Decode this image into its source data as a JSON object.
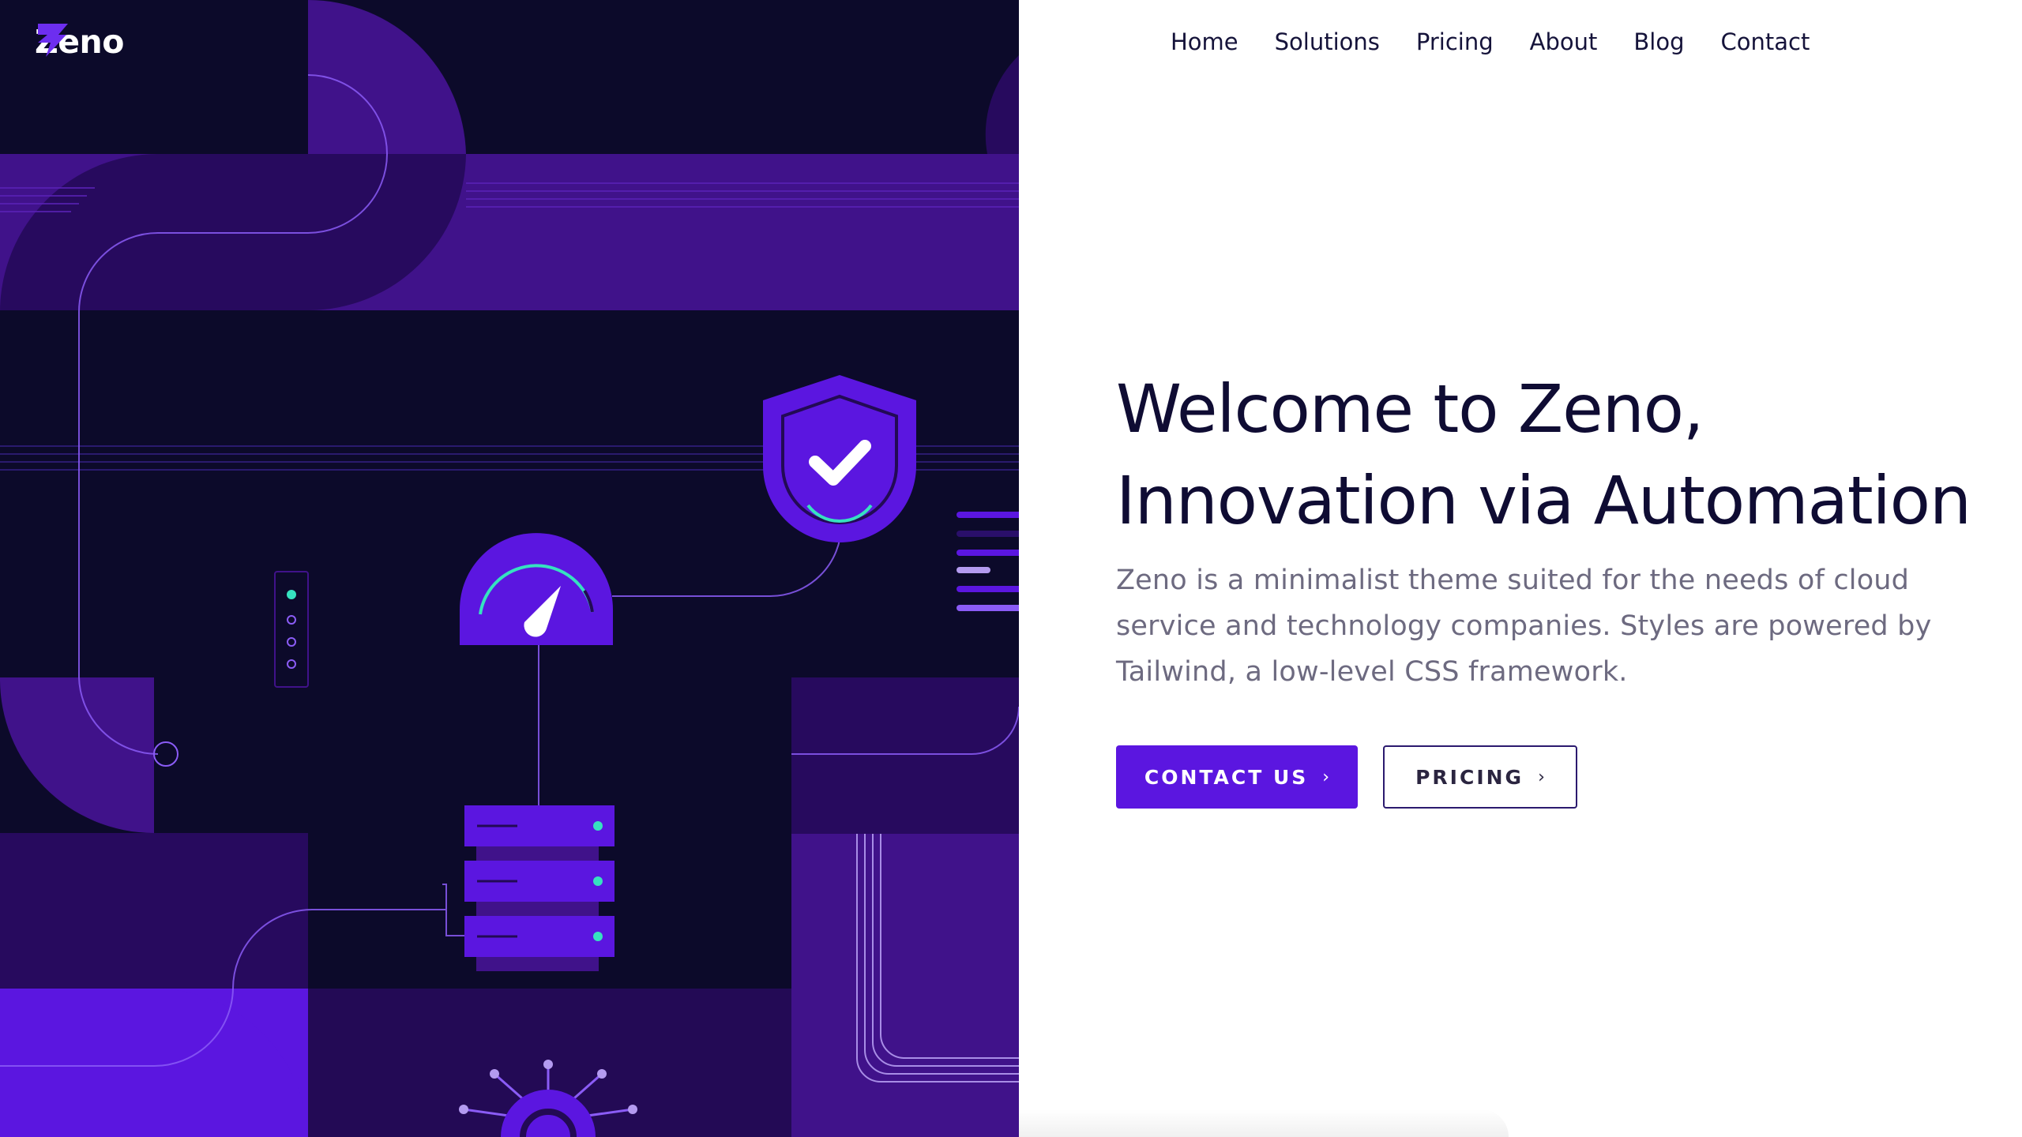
{
  "brand": {
    "name": "Zeno",
    "logo_icon": "lightning-bolt-logo",
    "accent": "#5b16e0",
    "dark_bg": "#0c0a2a"
  },
  "nav": {
    "items": [
      {
        "label": "Home"
      },
      {
        "label": "Solutions"
      },
      {
        "label": "Pricing"
      },
      {
        "label": "About"
      },
      {
        "label": "Blog"
      },
      {
        "label": "Contact"
      }
    ]
  },
  "hero": {
    "title_line1": "Welcome to Zeno,",
    "title_line2": "Innovation via Automation",
    "description": "Zeno is a minimalist theme suited for the needs of cloud service and technology companies. Styles are powered by Tailwind, a low-level CSS framework.",
    "primary_button": "CONTACT US",
    "secondary_button": "PRICING"
  },
  "illustration": {
    "icons": [
      "shield-check-icon",
      "speedometer-icon",
      "server-stack-icon",
      "status-dots-icon",
      "hub-node-icon"
    ],
    "colors": {
      "violet": "#5b16e0",
      "deep_violet": "#40128a",
      "dark_violet": "#230a55",
      "mint": "#36e2c0"
    }
  }
}
